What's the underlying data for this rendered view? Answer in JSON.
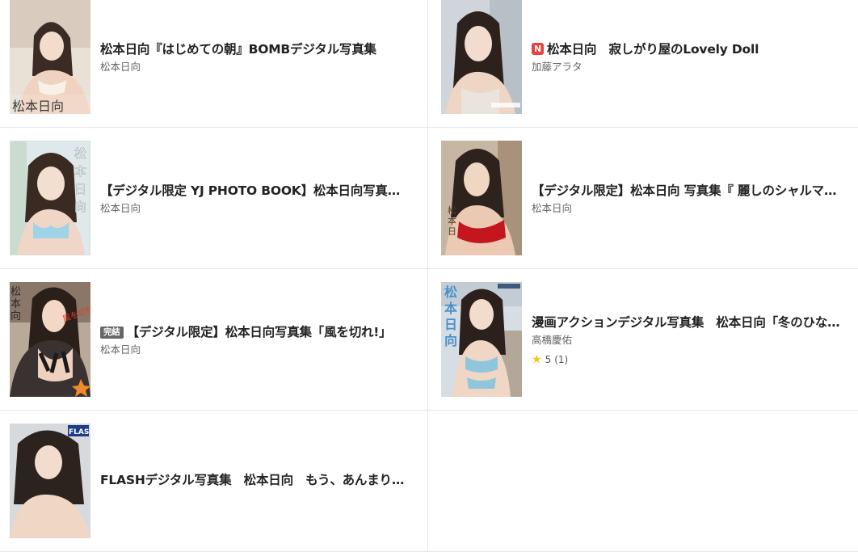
{
  "items": [
    {
      "title": "松本日向『はじめての朝』BOMBデジタル写真集",
      "author": "松本日向",
      "cover_text": "松本日向"
    },
    {
      "badge": "N",
      "title": "松本日向　寂しがり屋のLovely Doll",
      "author": "加藤アラタ"
    },
    {
      "title": "【デジタル限定 YJ PHOTO BOOK】松本日向写真集「…",
      "author": "松本日向",
      "cover_text": "松本日向"
    },
    {
      "title": "【デジタル限定】松本日向 写真集『 麗しのシャルマン 』",
      "author": "松本日向",
      "cover_text": "松本日向"
    },
    {
      "badge": "完結",
      "title": "【デジタル限定】松本日向写真集「風を切れ!」",
      "author": "松本日向",
      "cover_text": "松本日向"
    },
    {
      "title": "漫画アクションデジタル写真集　松本日向「冬のひな…",
      "author": "高橋慶佑",
      "rating": "5",
      "rating_count": "(1)",
      "cover_text": "松本日向"
    },
    {
      "title": "FLASHデジタル写真集　松本日向　もう、あんまり見ん…",
      "author": "",
      "cover_text": "FLASH"
    }
  ],
  "colors": {
    "badge_new": "#e8413e",
    "badge_done": "#666666",
    "star": "#f5c518"
  },
  "icons": {
    "rating": "star-icon"
  }
}
